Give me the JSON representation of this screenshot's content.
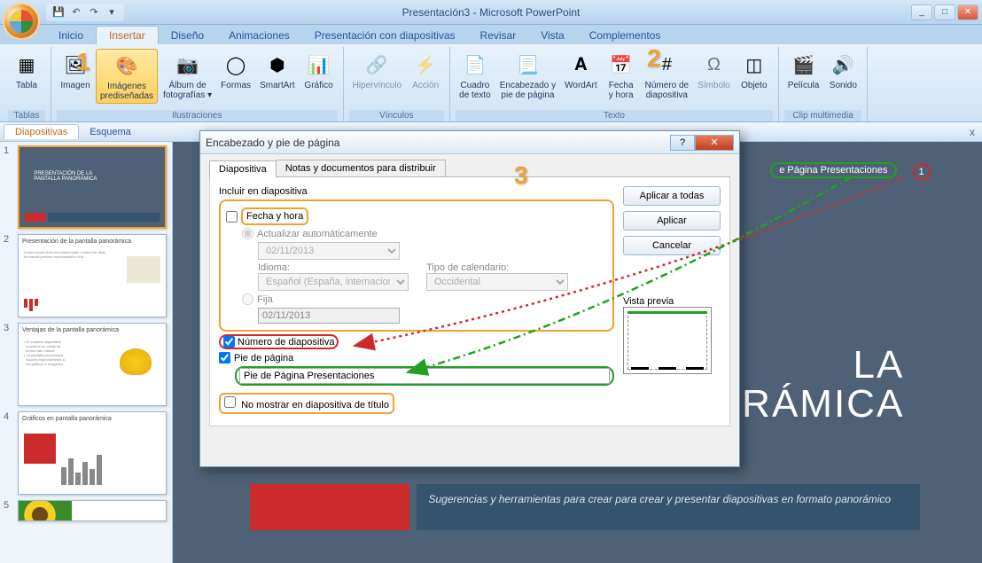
{
  "app": {
    "title": "Presentación3 - Microsoft PowerPoint"
  },
  "menu": {
    "tabs": [
      "Inicio",
      "Insertar",
      "Diseño",
      "Animaciones",
      "Presentación con diapositivas",
      "Revisar",
      "Vista",
      "Complementos"
    ],
    "active_index": 1
  },
  "ribbon": {
    "groups": [
      {
        "title": "Tablas",
        "items": [
          {
            "label": "Tabla",
            "icon": "▦"
          }
        ]
      },
      {
        "title": "Ilustraciones",
        "items": [
          {
            "label": "Imagen",
            "icon": "🖼"
          },
          {
            "label": "Imágenes\nprediseñadas",
            "icon": "🎨",
            "selected": true
          },
          {
            "label": "Álbum de\nfotografías ▾",
            "icon": "📷"
          },
          {
            "label": "Formas",
            "icon": "◯"
          },
          {
            "label": "SmartArt",
            "icon": "⬢"
          },
          {
            "label": "Gráfico",
            "icon": "📊"
          }
        ]
      },
      {
        "title": "Vínculos",
        "items": [
          {
            "label": "Hipervínculo",
            "icon": "🔗",
            "disabled": true
          },
          {
            "label": "Acción",
            "icon": "⚡",
            "disabled": true
          }
        ]
      },
      {
        "title": "Texto",
        "items": [
          {
            "label": "Cuadro\nde texto",
            "icon": "📄"
          },
          {
            "label": "Encabezado y\npie de página",
            "icon": "📃"
          },
          {
            "label": "WordArt",
            "icon": "𝐀"
          },
          {
            "label": "Fecha\ny hora",
            "icon": "📅"
          },
          {
            "label": "Número de\ndiapositiva",
            "icon": "#"
          },
          {
            "label": "Símbolo",
            "icon": "Ω",
            "disabled": true
          },
          {
            "label": "Objeto",
            "icon": "◫"
          }
        ]
      },
      {
        "title": "Clip multimedia",
        "items": [
          {
            "label": "Película",
            "icon": "🎬"
          },
          {
            "label": "Sonido",
            "icon": "🔊"
          }
        ]
      }
    ]
  },
  "sec_tabs": {
    "tabs": [
      "Diapositivas",
      "Esquema"
    ],
    "active_index": 0,
    "close": "x"
  },
  "thumbs": [
    {
      "num": "1",
      "selected": true
    },
    {
      "num": "2",
      "title": "Presentación de la pantalla panorámica"
    },
    {
      "num": "3",
      "title": "Ventajas de la pantalla panorámica"
    },
    {
      "num": "4",
      "title": "Gráficos en pantalla panorámica"
    },
    {
      "num": "5"
    }
  ],
  "slide": {
    "footer_text": "e Página Presentaciones",
    "number": "1",
    "title_line1": "LA",
    "title_line2": "PANTALLA PANORÁMICA",
    "subtitle": "Sugerencias y herramientas para crear para crear y presentar diapositivas en formato panorámico"
  },
  "dialog": {
    "title": "Encabezado y pie de página",
    "tabs": [
      "Diapositiva",
      "Notas y documentos para distribuir"
    ],
    "active_tab": 0,
    "group_label": "Incluir en diapositiva",
    "fecha_label": "Fecha y hora",
    "fecha_checked": false,
    "auto_label": "Actualizar automáticamente",
    "auto_selected": true,
    "date_value": "02/11/2013",
    "idioma_label": "Idioma:",
    "idioma_value": "Español (España, internacional)",
    "calendario_label": "Tipo de calendario:",
    "calendario_value": "Occidental",
    "fija_label": "Fija",
    "fija_value": "02/11/2013",
    "numero_label": "Número de diapositiva",
    "numero_checked": true,
    "pie_label": "Pie de página",
    "pie_checked": true,
    "pie_value": "Pie de Página Presentaciones",
    "nomostrar_label": "No mostrar en diapositiva de título",
    "nomostrar_checked": false,
    "buttons": {
      "aplicar_todas": "Aplicar a todas",
      "aplicar": "Aplicar",
      "cancelar": "Cancelar"
    },
    "preview_label": "Vista previa"
  },
  "annotations": {
    "n1": "1",
    "n2": "2",
    "n3": "3"
  }
}
